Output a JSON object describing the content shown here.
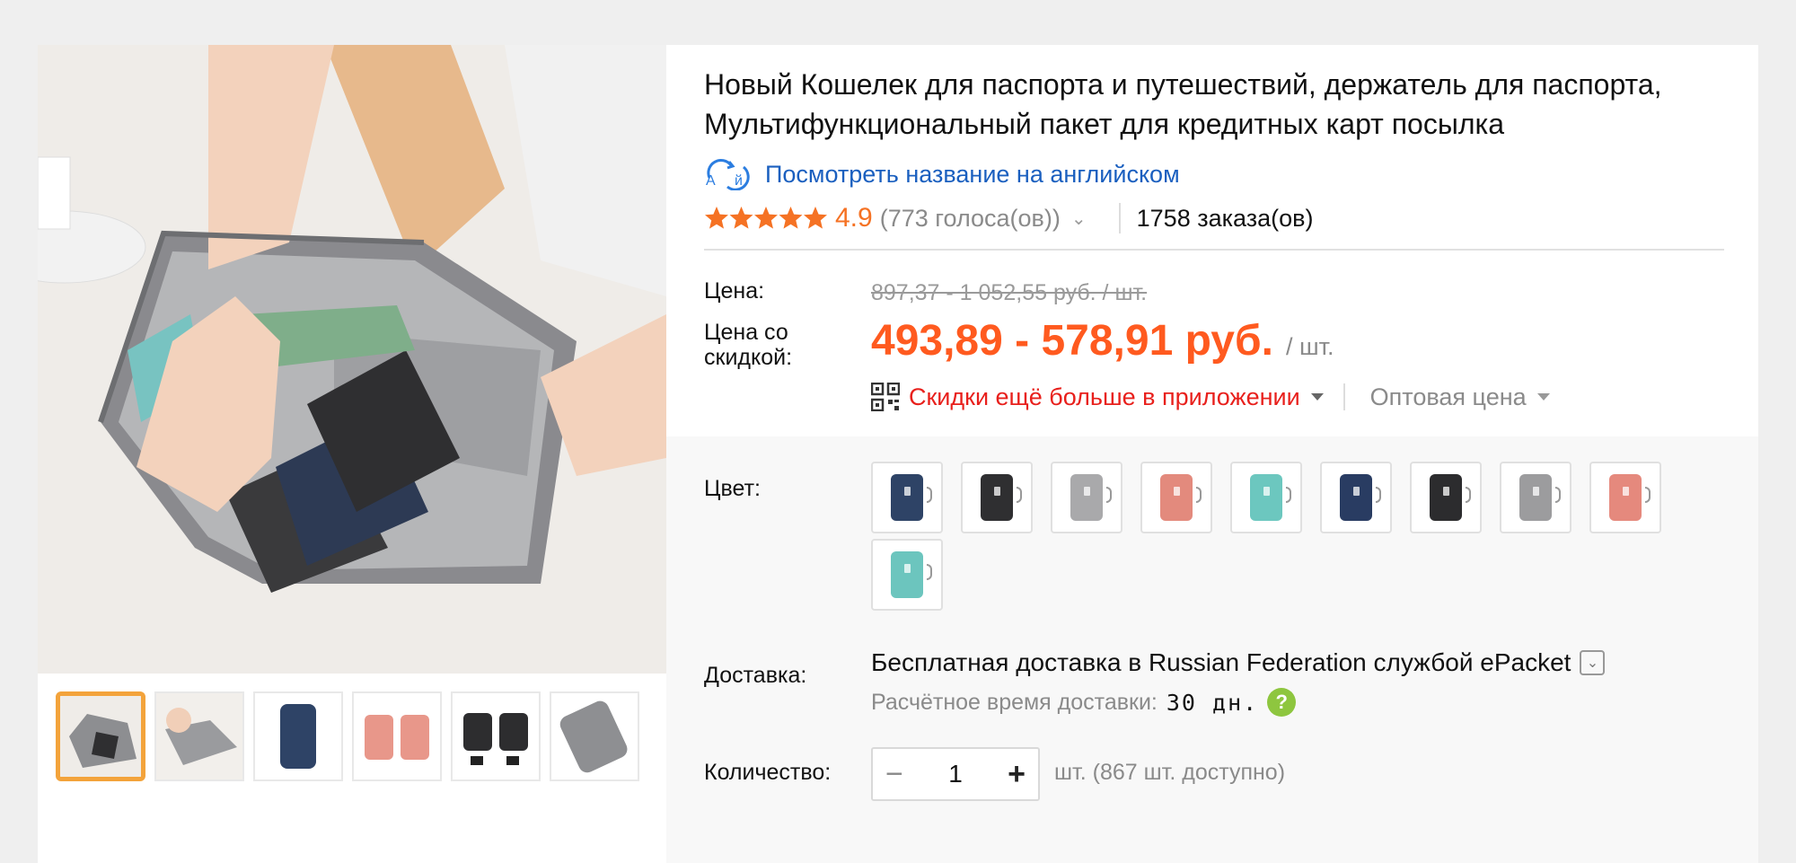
{
  "product": {
    "title_line1": "Новый Кошелек для паспорта и путешествий, держатель для паспорта,",
    "title_line2": "Мультифункциональный пакет для кредитных карт посылка",
    "translate_link": "Посмотреть название на английском"
  },
  "rating": {
    "stars": 5,
    "score": "4.9",
    "votes": "(773 голоса(ов))",
    "orders": "1758 заказа(ов)"
  },
  "price": {
    "label": "Цена:",
    "old": "897,37 - 1 052,55 руб. / шт.",
    "discount_label_line1": "Цена со",
    "discount_label_line2": "скидкой:",
    "new": "493,89 - 578,91 руб.",
    "unit": "/ шт.",
    "app_discount": "Скидки ещё больше в приложении",
    "wholesale": "Оптовая цена"
  },
  "color": {
    "label": "Цвет:",
    "options": [
      "#2e4366",
      "#2f2f31",
      "#a9a9ab",
      "#e38a7d",
      "#6cc7bf",
      "#293c62",
      "#2c2c2e",
      "#9c9c9e",
      "#e5897d",
      "#6cc5be"
    ]
  },
  "shipping": {
    "label": "Доставка:",
    "free_text": "Бесплатная доставка в",
    "destination": "Russian Federation службой ePacket",
    "eta_label": "Расчётное время доставки:",
    "eta_value": "30 дн.",
    "help_glyph": "?"
  },
  "quantity": {
    "label": "Количество:",
    "value": "1",
    "minus": "−",
    "plus": "+",
    "note": "шт. (867 шт. доступно)"
  },
  "thumbnails": [
    "main-wallet-in-hands",
    "wallet-lifestyle",
    "navy-wallet",
    "pink-wallets",
    "black-wallets",
    "grey-wallet"
  ],
  "colors": {
    "accent_orange": "#ff5a1f",
    "star_orange": "#f57224",
    "link_blue": "#1a5fbf",
    "app_red": "#e8201c",
    "thumb_selected": "#f3a33b"
  }
}
